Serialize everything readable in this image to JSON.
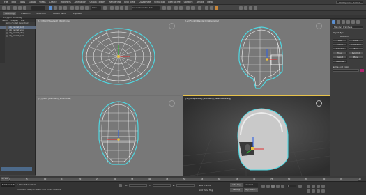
{
  "menubar": {
    "items": [
      "File",
      "Edit",
      "Tools",
      "Group",
      "Views",
      "Create",
      "Modifiers",
      "Animation",
      "Graph Editors",
      "Rendering",
      "Civil View",
      "Customize",
      "Scripting",
      "Interactive",
      "Content",
      "Arnold",
      "Help"
    ],
    "workspace": "Workspaces: Default"
  },
  "ribbon": {
    "tabs": [
      "Modeling",
      "Freeform",
      "Selection",
      "Object Paint",
      "Populate"
    ],
    "active": "Modeling",
    "subtitle": "Polygon Modeling"
  },
  "toolbar": {
    "view_dropdown": "View",
    "selection_set": "Create Selection Set"
  },
  "explorer": {
    "tabs": [
      "Select",
      "Display",
      "Edit"
    ],
    "header": "Name (Sorted Ascending)",
    "items": [
      "obj_helmet_body",
      "obj_helmet_visor",
      "obj_helmet_strap",
      "obj_helmet_pad"
    ]
  },
  "viewports": {
    "top": "[+] [Top] [Standard] [Wireframe]",
    "front": "[+] [Front] [Standard] [Wireframe]",
    "left": "[+] [Left] [Standard] [Wireframe]",
    "persp": "[+] [Perspective] [Standard] [Default Shading]"
  },
  "command_panel": {
    "section": "Standard Primitives",
    "object_type_title": "Object Type",
    "autogrid": "AutoGrid",
    "buttons": [
      "Box",
      "Cone",
      "Sphere",
      "GeoSphere",
      "Cylinder",
      "Tube",
      "Torus",
      "Pyramid",
      "Teapot",
      "Plane",
      "TextPlus"
    ],
    "name_color_title": "Name and Color",
    "swatch_color": "#b0246e"
  },
  "timeline": {
    "frame_label": "0 / 100",
    "ticks": [
      "0",
      "5",
      "10",
      "15",
      "20",
      "25",
      "30",
      "35",
      "40",
      "45",
      "50",
      "55",
      "60",
      "65",
      "70",
      "75",
      "80",
      "85",
      "90",
      "95",
      "100"
    ]
  },
  "status": {
    "selection": "1 Object Selected",
    "prompt": "Click and drag to select and move objects",
    "x_label": "X:",
    "y_label": "Y:",
    "z_label": "Z:",
    "grid": "Grid = 10.0",
    "addtime": "Add Time Tag",
    "autokey": "Auto Key",
    "selected": "Selected",
    "setkey": "Set Key",
    "keyfilters": "Key Filters...",
    "frame": "0",
    "script": "MAXScript Mi"
  },
  "colors": {
    "viewport_bg": "#787878",
    "active_border": "#e7c24a",
    "wire_selected": "#4fd6e0"
  }
}
